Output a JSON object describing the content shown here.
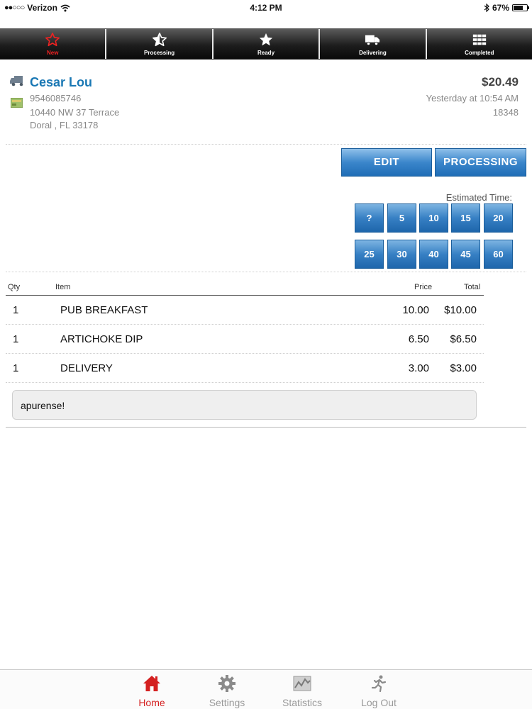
{
  "status_bar": {
    "carrier": "Verizon",
    "signal_dots": "●●○○○",
    "time": "4:12 PM",
    "battery": "67%",
    "battery_level": 0.67
  },
  "tabs": [
    {
      "label": "New",
      "icon": "star-outline-icon",
      "active": true
    },
    {
      "label": "Processing",
      "icon": "half-star-icon",
      "active": false
    },
    {
      "label": "Ready",
      "icon": "star-icon",
      "active": false
    },
    {
      "label": "Delivering",
      "icon": "truck-icon",
      "active": false
    },
    {
      "label": "Completed",
      "icon": "grid-icon",
      "active": false
    }
  ],
  "customer": {
    "name": "Cesar Lou",
    "phone": "9546085746",
    "address_line1": "10440 NW 37 Terrace",
    "address_line2": "Doral , FL 33178"
  },
  "order": {
    "total": "$20.49",
    "time": "Yesterday at 10:54 AM",
    "number": "18348"
  },
  "actions": {
    "edit_label": "EDIT",
    "processing_label": "PROCESSING"
  },
  "estimated": {
    "label": "Estimated Time:",
    "options": [
      "?",
      "5",
      "10",
      "15",
      "20",
      "25",
      "30",
      "40",
      "45",
      "60"
    ]
  },
  "items_table": {
    "headers": {
      "qty": "Qty",
      "item": "Item",
      "price": "Price",
      "total": "Total"
    },
    "rows": [
      {
        "qty": "1",
        "item": "PUB BREAKFAST",
        "price": "10.00",
        "total": "$10.00"
      },
      {
        "qty": "1",
        "item": "ARTICHOKE DIP",
        "price": "6.50",
        "total": "$6.50"
      },
      {
        "qty": "1",
        "item": "DELIVERY",
        "price": "3.00",
        "total": "$3.00"
      }
    ]
  },
  "note": "apurense!",
  "bottom_nav": [
    {
      "label": "Home",
      "icon": "home-icon",
      "active": true
    },
    {
      "label": "Settings",
      "icon": "gear-icon",
      "active": false
    },
    {
      "label": "Statistics",
      "icon": "statistics-icon",
      "active": false
    },
    {
      "label": "Log Out",
      "icon": "running-man-icon",
      "active": false
    }
  ],
  "colors": {
    "accent_blue": "#1a78b4",
    "button_blue": "#3b86cb",
    "active_red": "#e22222"
  }
}
